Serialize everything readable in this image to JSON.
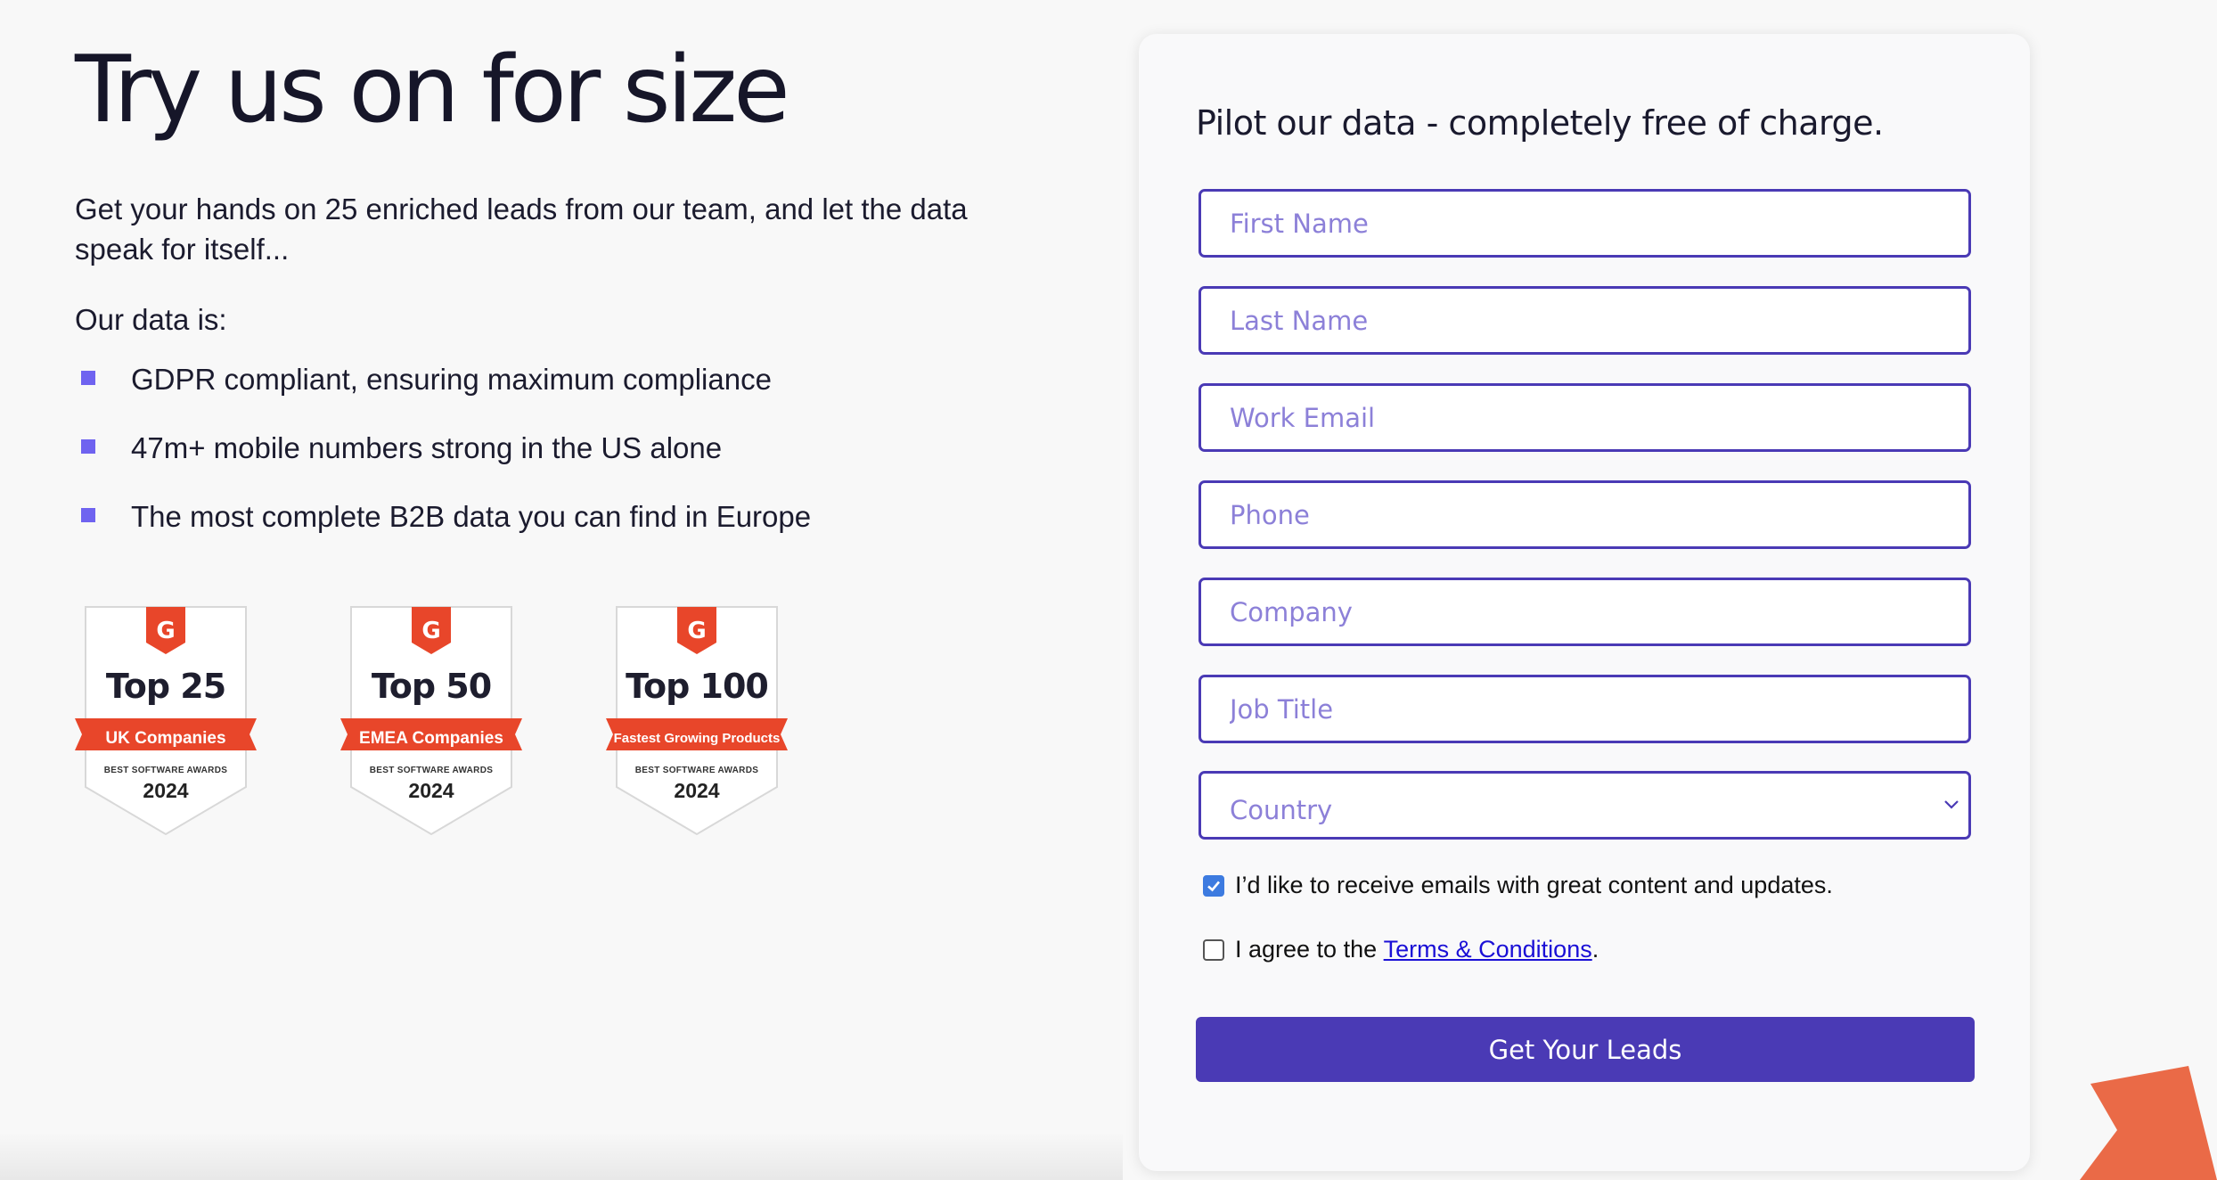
{
  "hero": {
    "headline": "Try us on for size",
    "intro": "Get your hands on 25 enriched leads from our team, and let the data speak for itself...",
    "data_is_label": "Our data is:",
    "bullets": [
      "GDPR compliant, ensuring maximum compliance",
      "47m+ mobile numbers strong in the US alone",
      "The most complete B2B data you can find in Europe"
    ]
  },
  "badges": [
    {
      "title": "Top 25",
      "ribbon": "UK Companies",
      "award": "BEST SOFTWARE AWARDS",
      "year": "2024"
    },
    {
      "title": "Top 50",
      "ribbon": "EMEA Companies",
      "award": "BEST SOFTWARE AWARDS",
      "year": "2024"
    },
    {
      "title": "Top 100",
      "ribbon": "Fastest Growing Products",
      "award": "BEST SOFTWARE AWARDS",
      "year": "2024"
    }
  ],
  "form": {
    "title": "Pilot our data - completely free of charge.",
    "fields": {
      "first_name": "First Name",
      "last_name": "Last Name",
      "work_email": "Work Email",
      "phone": "Phone",
      "company": "Company",
      "job_title": "Job Title",
      "country": "Country"
    },
    "consent_emails": {
      "label": "I’d like to receive emails with great content and updates.",
      "checked": true
    },
    "consent_terms": {
      "prefix": "I agree to the ",
      "link": "Terms & Conditions",
      "suffix": ".",
      "checked": false
    },
    "submit_label": "Get Your Leads"
  },
  "colors": {
    "accent": "#4a3ab5",
    "placeholder": "#8c80d8",
    "bullet": "#6f63f0",
    "badge_red": "#e8462a",
    "decor_orange": "#ea6a47"
  },
  "icons": {
    "bullet": "square-bullet-icon",
    "badge_logo": "g2-logo-icon",
    "select": "chevron-down-icon",
    "checkbox": "check-icon"
  }
}
